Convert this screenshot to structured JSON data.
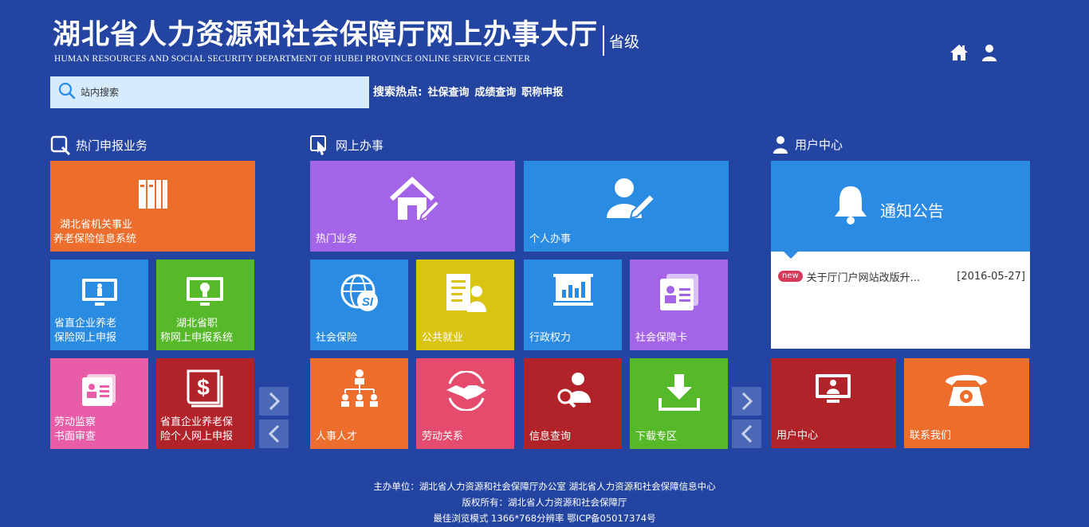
{
  "header": {
    "title": "湖北省人力资源和社会保障厅网上办事大厅",
    "level": "省级",
    "subtitle_en": "HUMAN RESOURCES AND SOCIAL SECURITY DEPARTMENT OF HUBEI PROVINCE ONLINE SERVICE CENTER",
    "home_icon": "home-icon",
    "user_icon": "user-icon"
  },
  "search": {
    "placeholder": "站内搜索",
    "hot_label": "搜索热点:",
    "hot_links": [
      "社保查询",
      "成绩查询",
      "职称申报"
    ]
  },
  "sections": {
    "hot_services": "热门申报业务",
    "online_services": "网上办事",
    "user_center": "用户中心"
  },
  "hot_tiles": [
    {
      "line1": "湖北省机关事业",
      "line2": "养老保险信息系统",
      "color": "#ec6d2c"
    },
    {
      "line1": "省直企业养老",
      "line2": "保险网上申报",
      "color": "#2a8be2"
    },
    {
      "line1": "湖北省职",
      "line2": "称网上申报系统",
      "color": "#56b92a"
    },
    {
      "line1": "劳动监察",
      "line2": "书面审查",
      "color": "#e85ca8"
    },
    {
      "line1": "省直企业养老保",
      "line2": "险个人网上申报",
      "color": "#b22229"
    }
  ],
  "online_tiles": [
    {
      "label": "热门业务",
      "color": "#a464e8"
    },
    {
      "label": "个人办事",
      "color": "#2a8be2"
    },
    {
      "label": "社会保险",
      "color": "#2a8be2"
    },
    {
      "label": "公共就业",
      "color": "#d9c412"
    },
    {
      "label": "行政权力",
      "color": "#2a8be2"
    },
    {
      "label": "社会保障卡",
      "color": "#a464e8"
    },
    {
      "label": "人事人才",
      "color": "#ec6d2c"
    },
    {
      "label": "劳动关系",
      "color": "#e44b6c"
    },
    {
      "label": "信息查询",
      "color": "#b22229"
    },
    {
      "label": "下载专区",
      "color": "#56b92a"
    }
  ],
  "notice": {
    "title": "通知公告",
    "badge": "new",
    "item_text": "关于厅门户网站改版升...",
    "item_date": "[2016-05-27]"
  },
  "user_tiles": [
    {
      "label": "用户中心",
      "color": "#b22229"
    },
    {
      "label": "联系我们",
      "color": "#ec6d2c"
    }
  ],
  "footer": {
    "line1": "主办单位：湖北省人力资源和社会保障厅办公室  湖北省人力资源和社会保障信息中心",
    "line2": "版权所有：湖北省人力资源和社会保障厅",
    "line3": "最佳浏览模式  1366*768分辨率  鄂ICP备05017374号"
  }
}
